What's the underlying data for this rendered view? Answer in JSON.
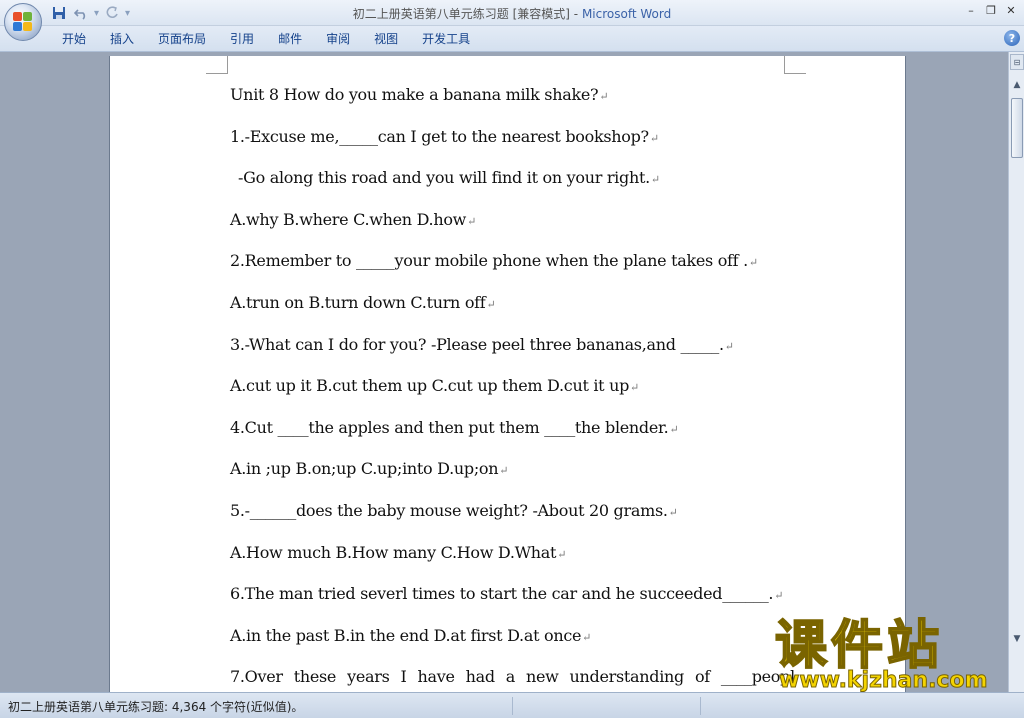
{
  "window": {
    "title_doc": "初二上册英语第八单元练习题 [兼容模式]",
    "title_sep": " - ",
    "title_app": "Microsoft Word",
    "minimize": "–",
    "restore": "❐",
    "close": "✕"
  },
  "qat": {
    "separator": "▾"
  },
  "ribbon": {
    "tabs": [
      "开始",
      "插入",
      "页面布局",
      "引用",
      "邮件",
      "审阅",
      "视图",
      "开发工具"
    ],
    "help": "?"
  },
  "document": {
    "lines": [
      "Unit 8     How do you make a banana milk shake?",
      "1.-Excuse me,_____can I get to the nearest bookshop?",
      "-Go along this road and you will find it on your right.",
      "A.why     B.where        C.when        D.how",
      "2.Remember to _____your mobile phone when the plane takes off .",
      "A.trun on      B.turn down      C.turn off",
      "3.-What can I do for you? -Please peel three bananas,and _____.",
      "A.cut up it      B.cut them up       C.cut up them    D.cut it up",
      "4.Cut ____the apples and then put them ____the blender.",
      "A.in ;up           B.on;up             C.up;into           D.up;on",
      "5.-______does the baby mouse weight? -About 20 grams.",
      "A.How much      B.How many       C.How         D.What",
      "6.The man tried severl times to start the car and he succeeded______.",
      "A.in the past         B.in the end          D.at first        D.at once"
    ],
    "last_line_words": [
      "7.Over",
      "these",
      "years",
      "I",
      "have",
      "had",
      "a",
      "new",
      "understanding",
      "of",
      "____peopl"
    ],
    "paragraph_mark": "↵"
  },
  "scrollbar": {
    "up": "▲",
    "down": "▼",
    "ruler": "⊟"
  },
  "status": {
    "text": "初二上册英语第八单元练习题: 4,364 个字符(近似值)。"
  },
  "watermark": {
    "cn": "课件站",
    "url": "www.kjzhan.com"
  },
  "colors": {
    "accent": "#15428b",
    "watermark": "#f4d400"
  }
}
